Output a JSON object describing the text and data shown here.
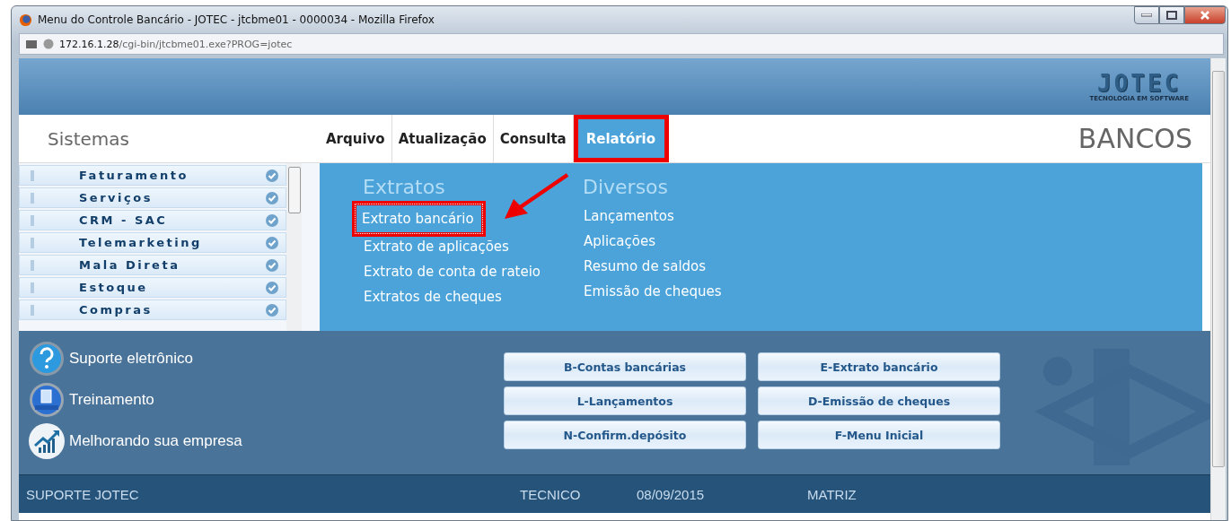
{
  "window": {
    "title": "Menu do Controle Bancário - JOTEC - jtcbme01 - 0000034 - Mozilla Firefox"
  },
  "address_bar": {
    "host": "172.16.1.28",
    "path": "/cgi-bin/jtcbme01.exe?PROG=jotec"
  },
  "header": {
    "logo": "JOTEC",
    "tagline": "TECNOLOGIA EM SOFTWARE"
  },
  "sidebar": {
    "title": "Sistemas",
    "items": [
      {
        "label": "Faturamento"
      },
      {
        "label": "Serviços"
      },
      {
        "label": "CRM - SAC"
      },
      {
        "label": "Telemarketing"
      },
      {
        "label": "Mala Direta"
      },
      {
        "label": "Estoque"
      },
      {
        "label": "Compras"
      }
    ]
  },
  "menu": {
    "tabs": [
      {
        "label": "Arquivo",
        "selected": false,
        "highlighted": false
      },
      {
        "label": "Atualização",
        "selected": false,
        "highlighted": false
      },
      {
        "label": "Consulta",
        "selected": false,
        "highlighted": false
      },
      {
        "label": "Relatório",
        "selected": true,
        "highlighted": true
      }
    ],
    "module": "BANCOS"
  },
  "dropdown": {
    "pointer_arrow": true,
    "columns": [
      {
        "heading": "Extratos",
        "items": [
          {
            "label": "Extrato bancário",
            "focused": true,
            "highlighted": true
          },
          {
            "label": "Extrato de aplicações",
            "focused": false,
            "highlighted": false
          },
          {
            "label": "Extrato de conta de rateio",
            "focused": false,
            "highlighted": false
          },
          {
            "label": "Extratos de cheques",
            "focused": false,
            "highlighted": false
          }
        ]
      },
      {
        "heading": "Diversos",
        "items": [
          {
            "label": "Lançamentos",
            "focused": false,
            "highlighted": false
          },
          {
            "label": "Aplicações",
            "focused": false,
            "highlighted": false
          },
          {
            "label": "Resumo de saldos",
            "focused": false,
            "highlighted": false
          },
          {
            "label": "Emissão de cheques",
            "focused": false,
            "highlighted": false
          }
        ]
      }
    ]
  },
  "links": [
    {
      "kind": "help",
      "label": "Suporte eletrônico"
    },
    {
      "kind": "training",
      "label": "Treinamento"
    },
    {
      "kind": "growth",
      "label": "Melhorando sua empresa"
    }
  ],
  "shortcuts": [
    {
      "label": "B-Contas bancárias"
    },
    {
      "label": "E-Extrato bancário"
    },
    {
      "label": "L-Lançamentos"
    },
    {
      "label": "D-Emissão de cheques"
    },
    {
      "label": "N-Confirm.depósito"
    },
    {
      "label": "F-Menu Inicial"
    }
  ],
  "status_bar": {
    "left": "SUPORTE JOTEC",
    "user": "TECNICO",
    "date": "08/09/2015",
    "branch": "MATRIZ"
  }
}
